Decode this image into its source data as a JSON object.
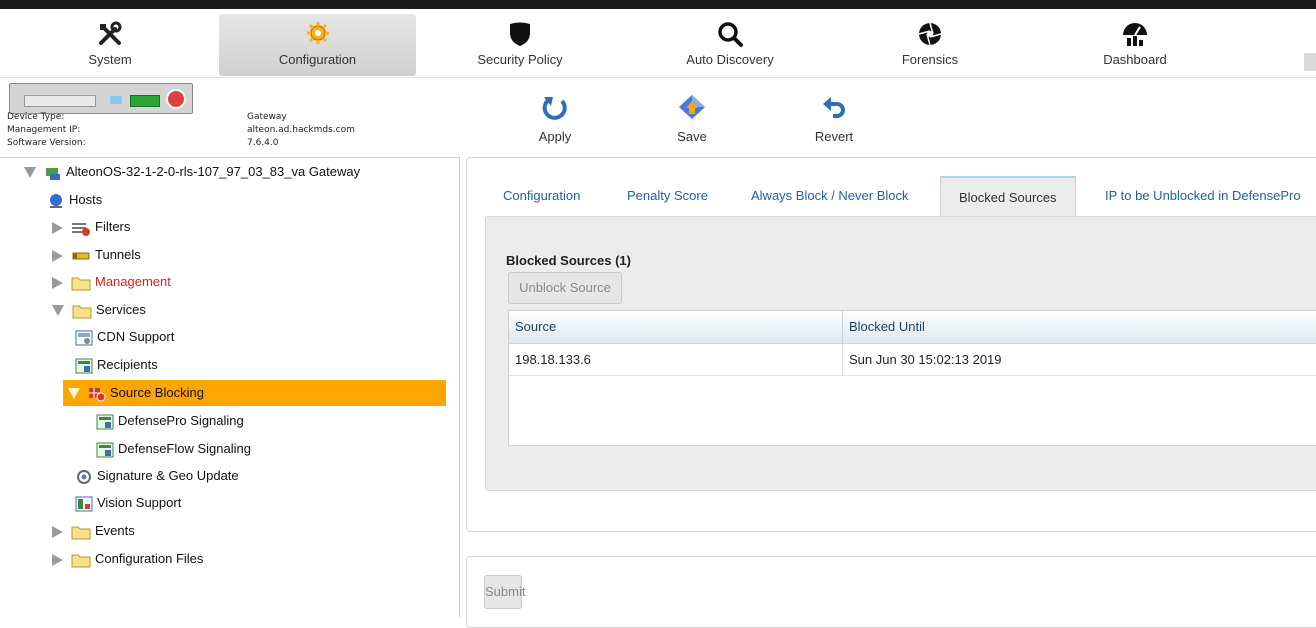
{
  "nav": {
    "items": [
      {
        "label": "System",
        "icon": "tools-icon"
      },
      {
        "label": "Configuration",
        "icon": "gear-icon",
        "active": true
      },
      {
        "label": "Security Policy",
        "icon": "shield-icon"
      },
      {
        "label": "Auto Discovery",
        "icon": "search-icon"
      },
      {
        "label": "Forensics",
        "icon": "aperture-icon"
      },
      {
        "label": "Dashboard",
        "icon": "gauge-icon"
      }
    ]
  },
  "device": {
    "type_label": "Device Type:",
    "type_value": "Gateway",
    "ip_label": "Management IP:",
    "ip_value": "alteon.ad.hackmds.com",
    "version_label": "Software Version:",
    "version_value": "7.6.4.0"
  },
  "toolbar": {
    "apply": "Apply",
    "save": "Save",
    "revert": "Revert"
  },
  "tree": {
    "root": "AlteonOS-32-1-2-0-rls-107_97_03_83_va Gateway",
    "hosts": "Hosts",
    "filters": "Filters",
    "tunnels": "Tunnels",
    "management": "Management",
    "services": "Services",
    "cdn": "CDN Support",
    "recipients": "Recipients",
    "source_blocking": "Source Blocking",
    "defensepro": "DefensePro Signaling",
    "defenseflow": "DefenseFlow Signaling",
    "signature": "Signature & Geo Update",
    "vision": "Vision Support",
    "events": "Events",
    "config_files": "Configuration Files"
  },
  "tabs": {
    "configuration": "Configuration",
    "penalty": "Penalty Score",
    "always_never": "Always Block / Never Block",
    "blocked_sources": "Blocked Sources",
    "unblock_ip": "IP to be Unblocked in DefensePro"
  },
  "blocked": {
    "title": "Blocked Sources (1)",
    "unblock_button": "Unblock Source",
    "columns": {
      "source": "Source",
      "until": "Blocked Until"
    },
    "rows": [
      {
        "source": "198.18.133.6",
        "until": "Sun Jun 30 15:02:13 2019"
      }
    ]
  },
  "submit_label": "Submit",
  "colors": {
    "selection": "#ffa500",
    "link": "#1f5fa8",
    "management_red": "#d42020"
  }
}
